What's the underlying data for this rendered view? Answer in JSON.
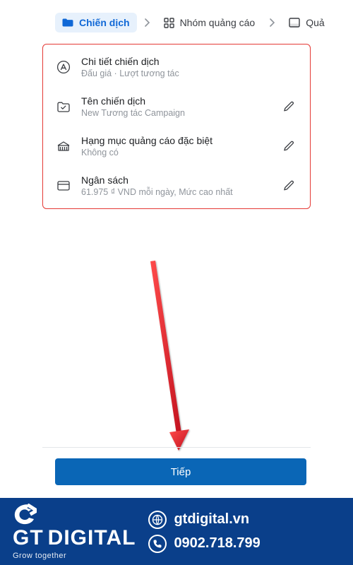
{
  "breadcrumb": {
    "items": [
      {
        "label": "Chiến dịch",
        "active": true
      },
      {
        "label": "Nhóm quảng cáo",
        "active": false
      },
      {
        "label": "Quả",
        "active": false
      }
    ]
  },
  "panel": {
    "rows": [
      {
        "title": "Chi tiết chiến dịch",
        "subtitle": "Đấu giá · Lượt tương tác",
        "editable": false
      },
      {
        "title": "Tên chiến dịch",
        "subtitle": "New Tương tác Campaign",
        "editable": true
      },
      {
        "title": "Hạng mục quảng cáo đặc biệt",
        "subtitle": "Không có",
        "editable": true
      },
      {
        "title": "Ngân sách",
        "subtitle": "61.975 ₫ VND mỗi ngày, Mức cao nhất",
        "editable": true
      }
    ]
  },
  "actions": {
    "next_label": "Tiếp"
  },
  "brand": {
    "name_primary": "GT",
    "name_secondary": "DIGITAL",
    "tagline": "Grow together",
    "website": "gtdigital.vn",
    "phone": "0902.718.799"
  },
  "colors": {
    "accent": "#1068d6",
    "highlight_border": "#e53935",
    "primary_button": "#0a66b6",
    "brand_bg": "#0a3f8a",
    "arrow": "#e53935"
  }
}
